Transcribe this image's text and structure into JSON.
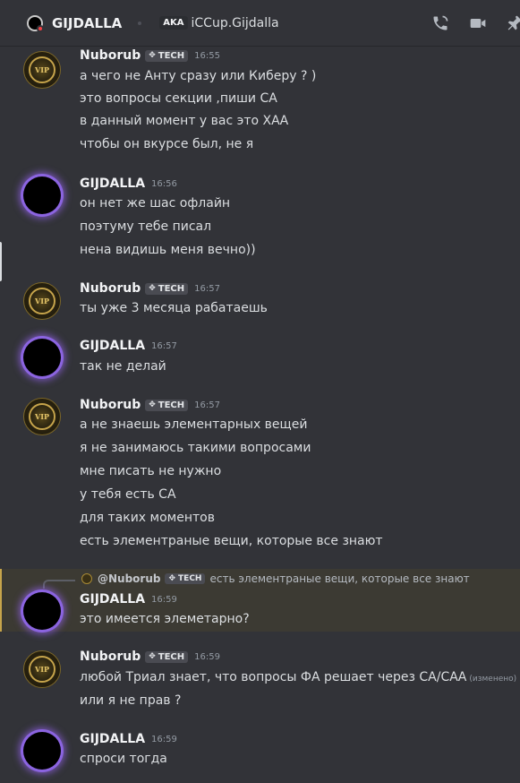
{
  "header": {
    "username": "GIJDALLA",
    "aka_label": "AKA",
    "aka_name": "iCCup.Gijdalla",
    "icons": [
      "phone-call-icon",
      "video-call-icon",
      "pin-icon"
    ]
  },
  "colors": {
    "background": "#323338",
    "highlight": "#3c3a33",
    "highlight_border": "#c6a44b",
    "avatar_glow": "#8b64e0"
  },
  "messages": [
    {
      "author": "Nuborub",
      "tag": "TECH",
      "time": "16:55",
      "avatar": "vip-avatar",
      "lines": [
        "а чего не Анту сразу или Киберу ? )",
        "это вопросы секции ,пиши СА",
        "в данный момент у вас это ХАА",
        "чтобы он вкурсе был, не я"
      ]
    },
    {
      "author": "GIJDALLA",
      "time": "16:56",
      "avatar": "black-avatar",
      "lines": [
        "он нет же шас офлайн",
        "поэтуму тебе писал",
        "нена видишь меня вечно))"
      ]
    },
    {
      "author": "Nuborub",
      "tag": "TECH",
      "time": "16:57",
      "avatar": "vip-avatar",
      "lines": [
        "ты уже 3 месяца рабатаешь"
      ]
    },
    {
      "author": "GIJDALLA",
      "time": "16:57",
      "avatar": "black-avatar",
      "lines": [
        "так не делай"
      ]
    },
    {
      "author": "Nuborub",
      "tag": "TECH",
      "time": "16:57",
      "avatar": "vip-avatar",
      "lines": [
        "а не знаешь элементарных вещей",
        "я не занимаюсь такими вопросами",
        "мне писать не нужно",
        "у тебя есть СА",
        "для таких моментов",
        "есть элементраные вещи, которые все знают"
      ]
    },
    {
      "author": "GIJDALLA",
      "time": "16:59",
      "avatar": "black-avatar",
      "reply": {
        "name": "@Nuborub",
        "tag": "TECH",
        "text": "есть элементраные вещи, которые все знают"
      },
      "lines": [
        "это имеется элеметарно?"
      ]
    },
    {
      "author": "Nuborub",
      "tag": "TECH",
      "time": "16:59",
      "avatar": "vip-avatar",
      "lines": [
        "любой Триал знает, что вопросы ФА решает через СА/САА",
        "или я не прав ?"
      ],
      "edited": "(изменено)"
    },
    {
      "author": "GIJDALLA",
      "time": "16:59",
      "avatar": "black-avatar",
      "lines": [
        "спроси тогда"
      ]
    }
  ]
}
